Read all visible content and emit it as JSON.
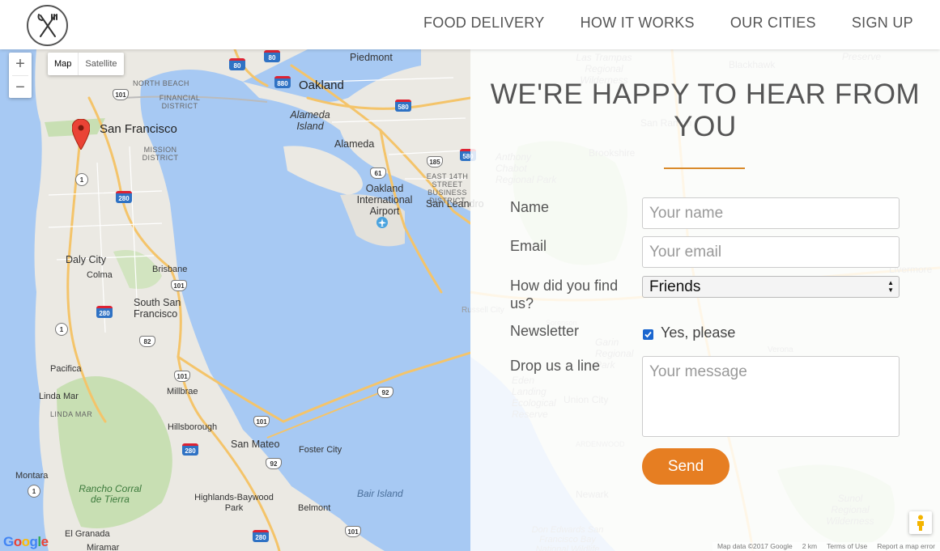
{
  "header": {
    "logo_icon": "fork-knife-icon",
    "nav": [
      {
        "label": "FOOD DELIVERY"
      },
      {
        "label": "HOW IT WORKS"
      },
      {
        "label": "OUR CITIES"
      },
      {
        "label": "SIGN UP"
      }
    ]
  },
  "map": {
    "controls": {
      "zoom_in": "+",
      "zoom_out": "−",
      "map_type": "Map",
      "satellite_type": "Satellite"
    },
    "marker_place": "San Francisco",
    "labels": {
      "san_francisco": "San Francisco",
      "oakland": "Oakland",
      "alameda": "Alameda",
      "alameda_island": "Alameda Island",
      "piedmont": "Piedmont",
      "oakland_airport": "Oakland International Airport",
      "san_leandro": "San Leandro",
      "daly_city": "Daly City",
      "colma": "Colma",
      "brisbane": "Brisbane",
      "south_sf": "South San Francisco",
      "pacifica": "Pacifica",
      "linda_mar": "Linda Mar",
      "millbrae": "Millbrae",
      "hillsborough": "Hillsborough",
      "san_mateo": "San Mateo",
      "foster_city": "Foster City",
      "montara": "Montara",
      "rancho": "Rancho Corral de Tierra",
      "highlands": "Highlands-Baywood Park",
      "bair_island": "Bair Island",
      "belmont": "Belmont",
      "el_granada": "El Granada",
      "miramar": "Miramar",
      "north_beach": "NORTH BEACH",
      "financial": "FINANCIAL DISTRICT",
      "mission": "MISSION DISTRICT",
      "east14": "EAST 14TH STREET BUSINESS DISTRICT",
      "linda_mar_small": "LINDA MAR",
      "russell_city": "Russell City",
      "las_trampas": "Las Trampas Regional Wilderness",
      "blackhawk": "Blackhawk",
      "preserve": "Preserve",
      "san_ramon": "San Ramon",
      "brookshire": "Brookshire",
      "anthony_chabot": "Anthony Chabot Regional Park",
      "castro_valley": "Castro Valley",
      "livermore": "Livermore",
      "pleasanton": "Pleasanton",
      "sorensen": "Sorenson",
      "garin": "Garin Regional Park",
      "verona": "Verona",
      "don_edwards": "Don Edwards San Francisco Bay National Wildlife Refuge",
      "union_city": "Union City",
      "eden_landing": "Eden Landing Ecological Reserve",
      "ardenwood": "ARDENWOOD",
      "newark": "Newark",
      "sunol": "Sunol Regional Wilderness"
    },
    "google": "Google",
    "attribution": [
      "Map data ©2017 Google",
      "2 km",
      "Terms of Use",
      "Report a map error"
    ]
  },
  "contact": {
    "title": "WE'RE HAPPY TO HEAR FROM YOU",
    "name_label": "Name",
    "name_placeholder": "Your name",
    "email_label": "Email",
    "email_placeholder": "Your email",
    "find_label": "How did you find us?",
    "find_selected": "Friends",
    "newsletter_label": "Newsletter",
    "newsletter_option": "Yes, please",
    "newsletter_checked": true,
    "message_label": "Drop us a line",
    "message_placeholder": "Your message",
    "send_label": "Send",
    "accent_color": "#e67e22"
  }
}
